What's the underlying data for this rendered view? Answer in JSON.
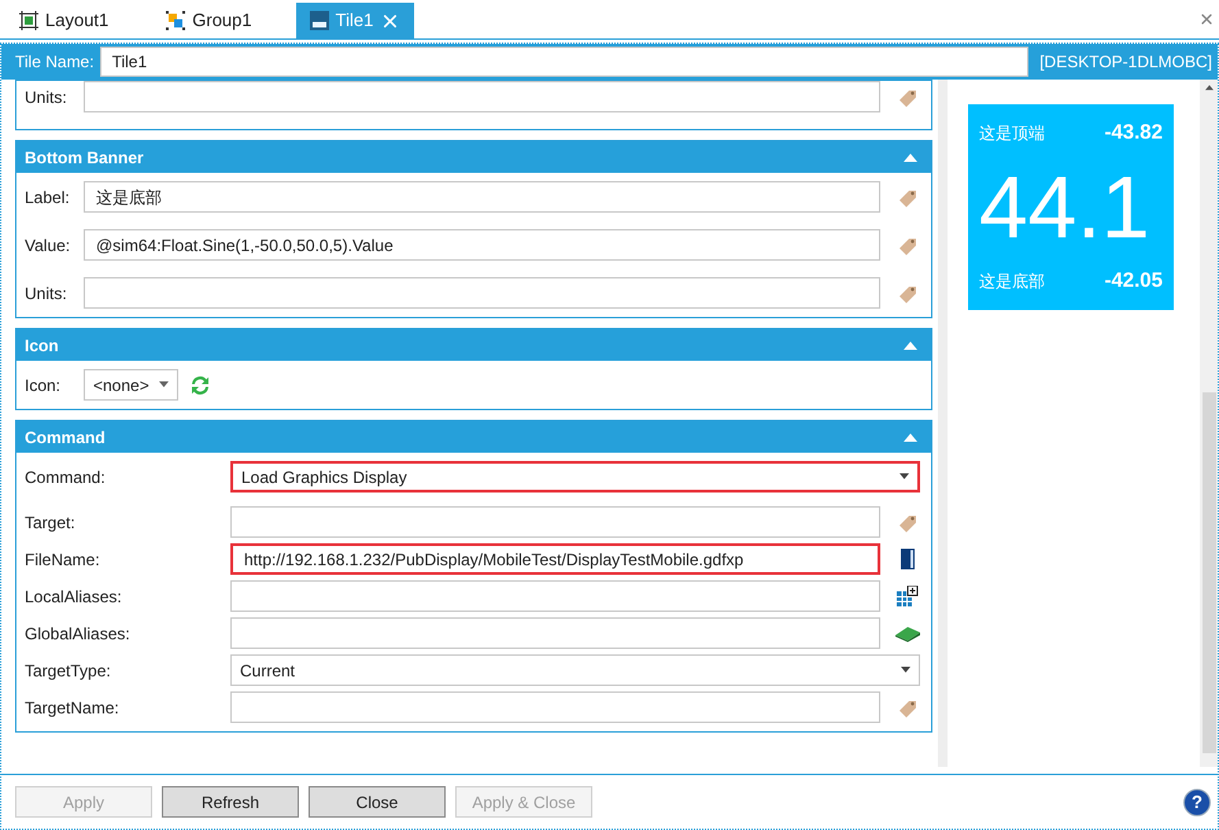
{
  "tabs": [
    {
      "label": "Layout1",
      "selected": false,
      "kind": "layout"
    },
    {
      "label": "Group1",
      "selected": false,
      "kind": "group"
    },
    {
      "label": "Tile1",
      "selected": true,
      "kind": "tile"
    }
  ],
  "header": {
    "label": "Tile Name:",
    "value": "Tile1",
    "host": "[DESKTOP-1DLMOBC]"
  },
  "sections": [
    {
      "kind": "partial",
      "rows": [
        {
          "label": "Units:",
          "kind": "tag-field",
          "value": "",
          "highlighted": false
        }
      ]
    },
    {
      "kind": "banner",
      "title": "Bottom Banner",
      "expanded": true,
      "rows": [
        {
          "label": "Label:",
          "kind": "tag-field",
          "value": "这是底部",
          "highlighted": false
        },
        {
          "label": "Value:",
          "kind": "tag-field",
          "value": "@sim64:Float.Sine(1,-50.0,50.0,5).Value",
          "highlighted": false
        },
        {
          "label": "Units:",
          "kind": "tag-field",
          "value": "",
          "highlighted": false
        }
      ]
    },
    {
      "kind": "icon",
      "title": "Icon",
      "expanded": true,
      "rows": [
        {
          "label": "Icon:",
          "kind": "icon-picker",
          "value": "<none>",
          "highlighted": false
        }
      ]
    },
    {
      "kind": "command",
      "title": "Command",
      "expanded": true,
      "rows": [
        {
          "label": "Command:",
          "kind": "dropdown",
          "value": "Load Graphics Display",
          "highlighted": true
        },
        {
          "label": "Target:",
          "kind": "tag-field",
          "value": "",
          "highlighted": false
        },
        {
          "label": "FileName:",
          "kind": "file-field",
          "value": "http://192.168.1.232/PubDisplay/MobileTest/DisplayTestMobile.gdfxp",
          "highlighted": true
        },
        {
          "label": "LocalAliases:",
          "kind": "table-field",
          "value": "",
          "highlighted": false
        },
        {
          "label": "GlobalAliases:",
          "kind": "book-field",
          "value": "",
          "highlighted": false
        },
        {
          "label": "TargetType:",
          "kind": "dropdown",
          "value": "Current",
          "highlighted": false
        },
        {
          "label": "TargetName:",
          "kind": "tag-field",
          "value": "",
          "highlighted": false
        }
      ]
    }
  ],
  "preview": {
    "top_label": "这是顶端",
    "top_value": "-43.82",
    "value": "44.1",
    "bottom_label": "这是底部",
    "bottom_value": "-42.05"
  },
  "buttons": [
    {
      "label": "Apply",
      "disabled": true
    },
    {
      "label": "Refresh",
      "disabled": false
    },
    {
      "label": "Close",
      "disabled": false
    },
    {
      "label": "Apply & Close",
      "disabled": true
    }
  ],
  "help": "?"
}
